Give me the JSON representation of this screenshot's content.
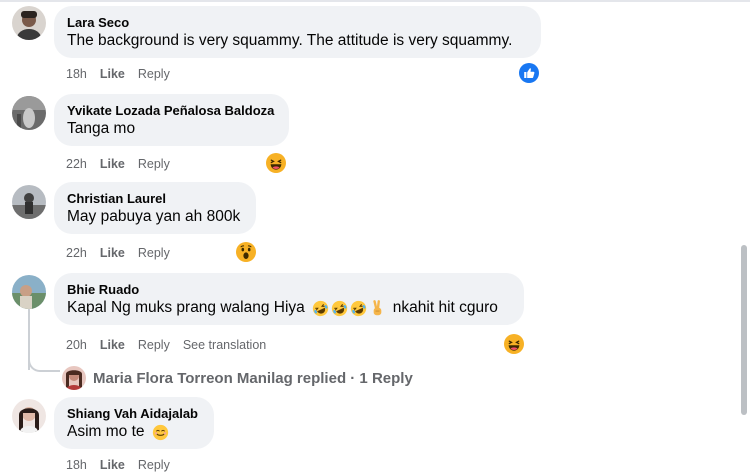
{
  "comments": [
    {
      "name": "Lara Seco",
      "text": "The background is very squammy. The attitude is very squammy.",
      "time": "18h",
      "like": "Like",
      "reply": "Reply",
      "reaction": "like-reaction-icon"
    },
    {
      "name": "Yvikate Lozada Peñalosa Baldoza",
      "text": "Tanga mo",
      "time": "22h",
      "like": "Like",
      "reply": "Reply",
      "reaction": "haha-reaction-icon"
    },
    {
      "name": "Christian Laurel",
      "text": "May pabuya yan ah 800k",
      "time": "22h",
      "like": "Like",
      "reply": "Reply",
      "reaction": "wow-reaction-icon"
    },
    {
      "name": "Bhie Ruado",
      "text_before": "Kapal Ng muks prang walang Hiya",
      "text_after": "nkahit hit cguro",
      "emojis": [
        "rolling-laughing-emoji-icon",
        "rolling-laughing-emoji-icon",
        "rolling-laughing-emoji-icon",
        "victory-hand-emoji-icon"
      ],
      "time": "20h",
      "like": "Like",
      "reply": "Reply",
      "see_translation": "See translation",
      "reaction": "haha-reaction-icon"
    },
    {
      "name": "Shiang Vah Aidajalab",
      "text": "Asim mo te",
      "text_emoji": "smiling-emoji-icon",
      "time": "18h",
      "like": "Like",
      "reply": "Reply"
    }
  ],
  "replies_summary": {
    "text": "Maria Flora Torreon Manilag replied · 1 Reply"
  },
  "colors": {
    "bubble": "#f0f2f5",
    "meta_text": "#65676b",
    "like_blue": "#1877f2",
    "haha_yellow": "#f7b125"
  }
}
